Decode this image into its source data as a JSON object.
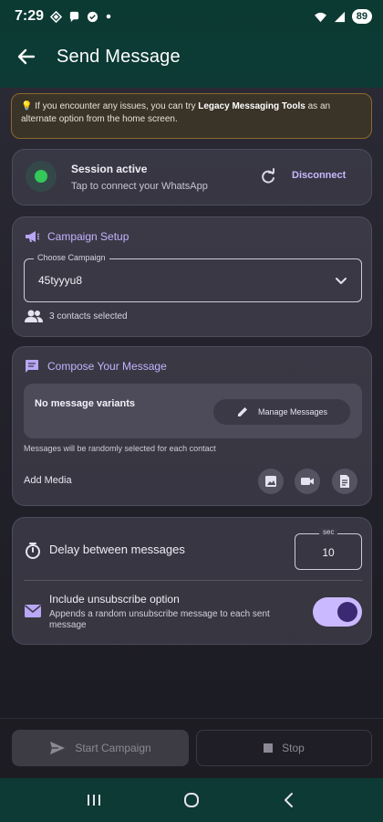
{
  "status_bar": {
    "time": "7:29",
    "battery": "89",
    "left_icons": [
      "gem-icon",
      "chat-bubble-icon",
      "circle-badge-icon",
      "dot-icon"
    ],
    "right_icons": [
      "wifi-icon",
      "signal-icon",
      "battery-icon"
    ]
  },
  "app_bar": {
    "title": "Send Message",
    "back_icon": "arrow-left-icon"
  },
  "notice": {
    "emoji": "💡",
    "text_before": " If you encounter any issues, you can try ",
    "bold_text": "Legacy Messaging Tools",
    "text_after": " as an alternate option from the home screen."
  },
  "session": {
    "title": "Session active",
    "subtitle": "Tap to connect your WhatsApp",
    "disconnect_label": "Disconnect",
    "status_color": "#34c759"
  },
  "campaign_setup": {
    "heading": "Campaign Setup",
    "field_label": "Choose Campaign",
    "field_value": "45tyyyu8",
    "contacts_text": "3 contacts selected"
  },
  "compose": {
    "heading": "Compose Your Message",
    "no_variants_text": "No message variants",
    "manage_label": "Manage Messages",
    "random_note": "Messages will be randomly selected for each contact",
    "add_media_label": "Add Media",
    "media_buttons": [
      "image-icon",
      "video-icon",
      "document-icon"
    ]
  },
  "settings": {
    "delay_label": "Delay between messages",
    "delay_unit": "sec",
    "delay_value": "10",
    "unsub_title": "Include unsubscribe option",
    "unsub_subtitle": "Appends a random unsubscribe message to each sent message",
    "unsub_enabled": true
  },
  "actions": {
    "start_label": "Start Campaign",
    "stop_label": "Stop"
  },
  "colors": {
    "accent": "#c5b3ff",
    "toggle_on": "#cab9ff",
    "header_bg": "#0d3a34"
  }
}
